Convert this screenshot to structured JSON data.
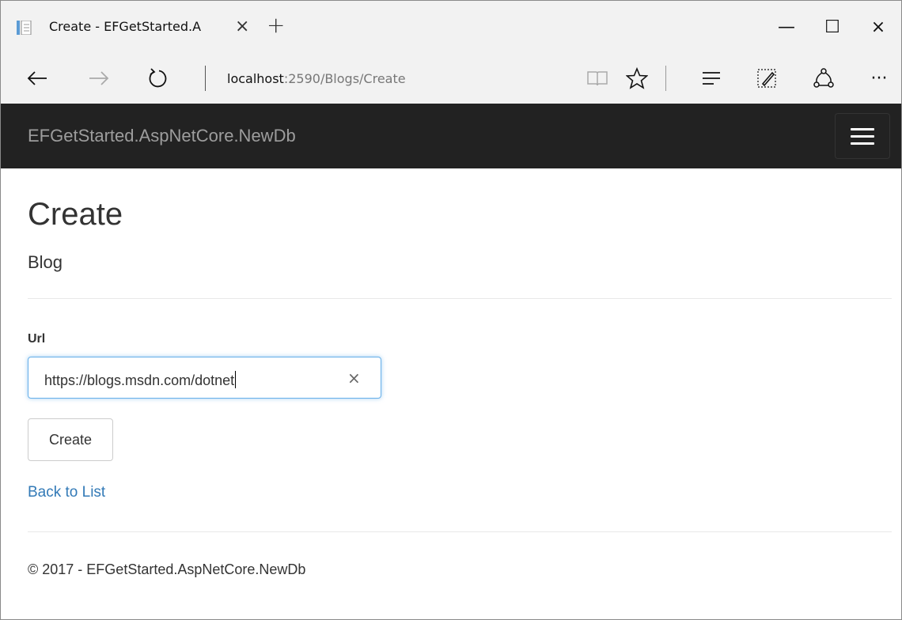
{
  "browser": {
    "tab": {
      "title": "Create - EFGetStarted.A",
      "close_glyph": "×",
      "favicon": "page-icon"
    },
    "new_tab_glyph": "+",
    "window_controls": {
      "minimize": "—",
      "maximize": "☐",
      "close": "×"
    },
    "nav": {
      "back": "back-arrow-icon",
      "forward": "forward-arrow-icon",
      "refresh": "refresh-icon"
    },
    "address": {
      "host": "localhost",
      "rest": ":2590/Blogs/Create"
    },
    "toolbar": {
      "reading_view": "reading-view-icon",
      "favorite": "star-icon",
      "hub": "hub-icon",
      "web_note": "web-note-icon",
      "share": "share-icon",
      "more": "···"
    }
  },
  "navbar": {
    "brand": "EFGetStarted.AspNetCore.NewDb",
    "background": "#222222",
    "toggle_icon": "hamburger-icon"
  },
  "page": {
    "heading": "Create",
    "subheading": "Blog",
    "form": {
      "url_label": "Url",
      "url_value": "https://blogs.msdn.com/dotnet",
      "clear_glyph": "×",
      "submit_label": "Create"
    },
    "back_link": "Back to List",
    "footer": "© 2017 - EFGetStarted.AspNetCore.NewDb",
    "link_color": "#337ab7"
  }
}
